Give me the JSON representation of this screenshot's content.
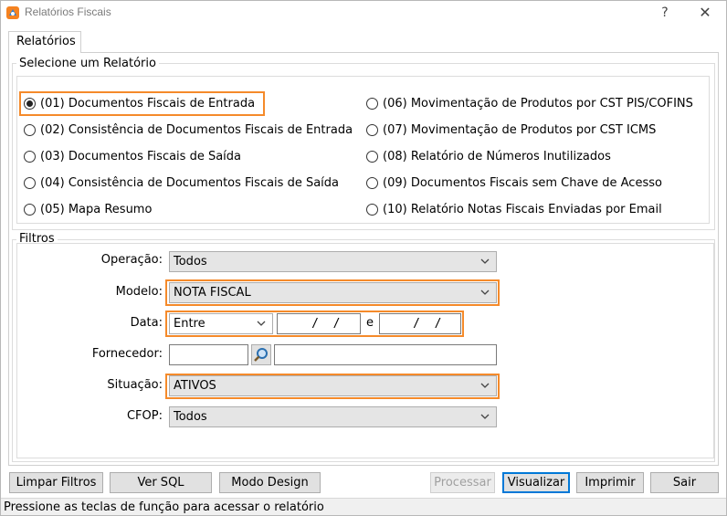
{
  "window": {
    "title": "Relatórios Fiscais",
    "help_label": "?",
    "close_label": "✕"
  },
  "tabs": [
    {
      "label": "Relatórios",
      "active": true
    }
  ],
  "report_group": {
    "label": "Selecione um Relatório",
    "options": [
      {
        "label": "(01) Documentos Fiscais de Entrada",
        "selected": true
      },
      {
        "label": "(02) Consistência de Documentos Fiscais de Entrada",
        "selected": false
      },
      {
        "label": "(03) Documentos Fiscais de Saída",
        "selected": false
      },
      {
        "label": "(04) Consistência de Documentos Fiscais de Saída",
        "selected": false
      },
      {
        "label": "(05) Mapa Resumo",
        "selected": false
      },
      {
        "label": "(06) Movimentação de Produtos por CST PIS/COFINS",
        "selected": false
      },
      {
        "label": "(07) Movimentação de Produtos por CST ICMS",
        "selected": false
      },
      {
        "label": "(08) Relatório de Números Inutilizados",
        "selected": false
      },
      {
        "label": "(09) Documentos Fiscais sem Chave de Acesso",
        "selected": false
      },
      {
        "label": "(10) Relatório Notas Fiscais Enviadas por Email",
        "selected": false
      }
    ]
  },
  "filters": {
    "label": "Filtros",
    "operacao": {
      "label": "Operação:",
      "value": "Todos"
    },
    "modelo": {
      "label": "Modelo:",
      "value": "NOTA FISCAL"
    },
    "data": {
      "label": "Data:",
      "mode": "Entre",
      "from": "  /  /",
      "separator": "e",
      "to": "  /  /"
    },
    "fornecedor": {
      "label": "Fornecedor:",
      "code": "",
      "name": ""
    },
    "situacao": {
      "label": "Situação:",
      "value": "ATIVOS"
    },
    "cfop": {
      "label": "CFOP:",
      "value": "Todos"
    }
  },
  "buttons": {
    "limpar": "Limpar Filtros",
    "sql": "Ver SQL",
    "design": "Modo Design",
    "processar": "Processar",
    "visualizar": "Visualizar",
    "imprimir": "Imprimir",
    "sair": "Sair"
  },
  "status": "Pressione as teclas de função para acessar o relatório",
  "colors": {
    "highlight": "#f58a2a",
    "focus_border": "#0078d7",
    "app_icon_orange": "#f58220",
    "app_icon_blue": "#2a7fd4"
  }
}
